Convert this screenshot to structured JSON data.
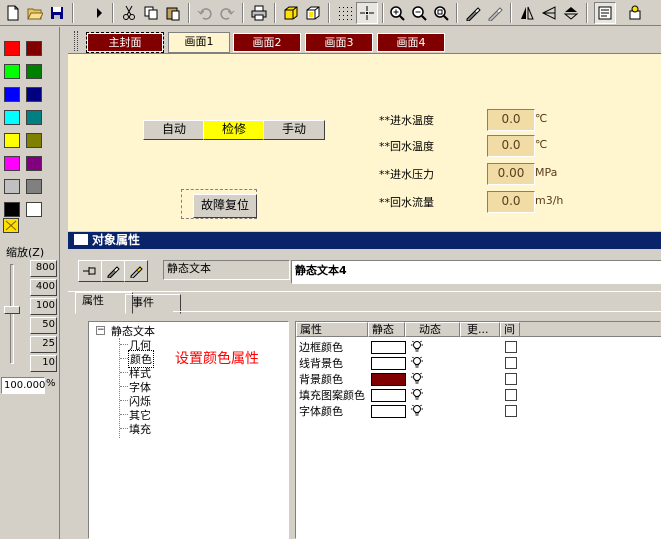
{
  "toolbar": {
    "icons": [
      "new-file-icon",
      "open-folder-icon",
      "save-icon",
      "run-icon",
      "cut-icon",
      "copy-icon",
      "paste-icon",
      "undo-icon",
      "redo-icon",
      "print-icon",
      "cube-icon",
      "cube-frame-icon",
      "grid-icon",
      "crosshair-icon",
      "zoom-in-icon",
      "zoom-out-icon",
      "zoom-fit-icon",
      "draw-tool-icon",
      "line-tool-icon",
      "flip-horizontal-icon",
      "flip-left-icon",
      "flip-vertical-icon",
      "properties-icon",
      "config-icon"
    ]
  },
  "palette": {
    "colors": [
      "#ff0000",
      "#800000",
      "#00ff00",
      "#008000",
      "#0000ff",
      "#000080",
      "#00ffff",
      "#008080",
      "#ffff00",
      "#808000",
      "#ff00ff",
      "#800080",
      "#c0c0c0",
      "#808080",
      "#000000",
      "#ffffff"
    ]
  },
  "zoom": {
    "title": "缩放(Z)",
    "levels": [
      "800",
      "400",
      "100",
      "50",
      "25",
      "10"
    ],
    "value": "100.000",
    "unit": "%"
  },
  "tabs": [
    {
      "label": "主封面",
      "selected": false
    },
    {
      "label": "画面1",
      "selected": true
    },
    {
      "label": "画面2",
      "selected": false
    },
    {
      "label": "画面3",
      "selected": false
    },
    {
      "label": "画面4",
      "selected": false
    }
  ],
  "canvas": {
    "mode_buttons": [
      "自动",
      "检修",
      "手动"
    ],
    "active_mode": "检修",
    "reset_button": "故障复位",
    "readings": [
      {
        "label": "**进水温度",
        "value": "0.0",
        "unit": "℃"
      },
      {
        "label": "**回水温度",
        "value": "0.0",
        "unit": "℃"
      },
      {
        "label": "**进水压力",
        "value": "0.00",
        "unit": "MPa"
      },
      {
        "label": "**回水流量",
        "value": "0.0",
        "unit": "m3/h"
      }
    ]
  },
  "props": {
    "title": "对象属性",
    "type_field": "静态文本",
    "name_field": "静态文本4",
    "tabs": [
      "属性",
      "事件"
    ],
    "tree": {
      "root": "静态文本",
      "children": [
        "几何",
        "颜色",
        "样式",
        "字体",
        "闪烁",
        "其它",
        "填充"
      ],
      "selected": "颜色"
    },
    "annotation": "设置颜色属性",
    "grid": {
      "headers": [
        "属性",
        "静态",
        "动态",
        "更...",
        "间"
      ],
      "rows": [
        {
          "name": "边框颜色",
          "color": "#ffffff"
        },
        {
          "name": "线背景色",
          "color": "#ffffff"
        },
        {
          "name": "背景颜色",
          "color": "#800000"
        },
        {
          "name": "填充图案颜色",
          "color": "#ffffff"
        },
        {
          "name": "字体颜色",
          "color": "#ffffff"
        }
      ]
    }
  },
  "colors": {
    "canvas_bg": "#fff6cf",
    "tab_bg": "#800000",
    "active_mode_bg": "#ffff00",
    "title_bar": "#0a246a",
    "annotation": "#ff0000"
  }
}
